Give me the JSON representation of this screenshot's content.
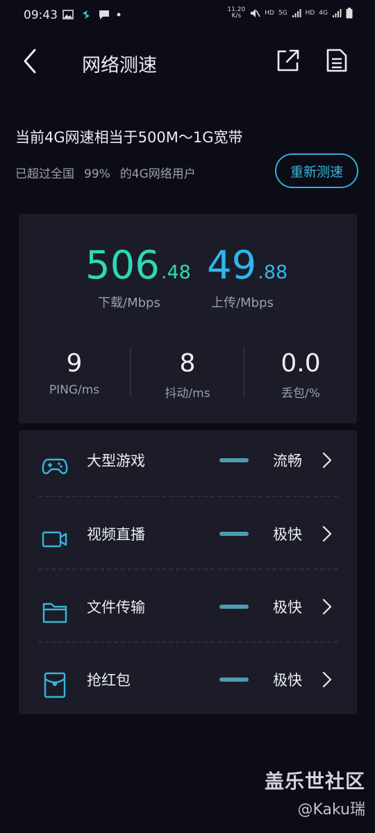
{
  "status_bar": {
    "time": "09:43",
    "speed_value": "11.20",
    "speed_unit": "K/s",
    "hd1": "HD",
    "net1": "5G",
    "hd2": "HD",
    "net2": "4G"
  },
  "header": {
    "title": "网络测速"
  },
  "summary": {
    "headline": "当前4G网速相当于500M～1G宽带",
    "sub_prefix": "已超过全国",
    "percent": "99%",
    "sub_suffix": "的4G网络用户",
    "retest_label": "重新测速"
  },
  "result": {
    "download_int": "506",
    "download_dec": ".48",
    "download_label": "下载/Mbps",
    "upload_int": "49",
    "upload_dec": ".88",
    "upload_label": "上传/Mbps",
    "ping_value": "9",
    "ping_label": "PING/ms",
    "jitter_value": "8",
    "jitter_label": "抖动/ms",
    "loss_value": "0.0",
    "loss_label": "丢包/%",
    "download_color": "#2fd8b6",
    "upload_color": "#2fb7ee"
  },
  "scenarios": [
    {
      "label": "大型游戏",
      "status": "流畅",
      "icon": "gamepad-icon"
    },
    {
      "label": "视频直播",
      "status": "极快",
      "icon": "video-camera-icon"
    },
    {
      "label": "文件传输",
      "status": "极快",
      "icon": "folder-icon"
    },
    {
      "label": "抢红包",
      "status": "极快",
      "icon": "red-packet-icon"
    }
  ],
  "watermark": {
    "line1": "盖乐世社区",
    "line2": "@Kaku瑞"
  },
  "colors": {
    "background": "#0c0c16",
    "card": "#1b1c28",
    "accent": "#2fb0d6",
    "icon": "#38b6dc"
  }
}
